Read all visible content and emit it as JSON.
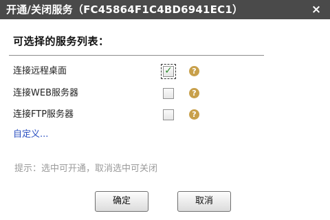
{
  "window": {
    "title": "开通/关闭服务（FC45864F1C4BD6941EC1）",
    "close_glyph": "×"
  },
  "section": {
    "heading": "可选择的服务列表："
  },
  "services": [
    {
      "label": "连接远程桌面",
      "checked": true,
      "help_glyph": "?"
    },
    {
      "label": "连接WEB服务器",
      "checked": false,
      "help_glyph": "?"
    },
    {
      "label": "连接FTP服务器",
      "checked": false,
      "help_glyph": "?"
    }
  ],
  "custom_link": "自定义...",
  "hint": "提示：选中可开通，取消选中可关闭",
  "buttons": {
    "ok": "确定",
    "cancel": "取消"
  },
  "check_glyph": "✓",
  "colors": {
    "title_bar": "#4a4a4a",
    "link": "#2a4fc0",
    "help_icon": "#c8a04b",
    "check": "#2e8b2e",
    "hint_text": "#9a9a9a"
  }
}
